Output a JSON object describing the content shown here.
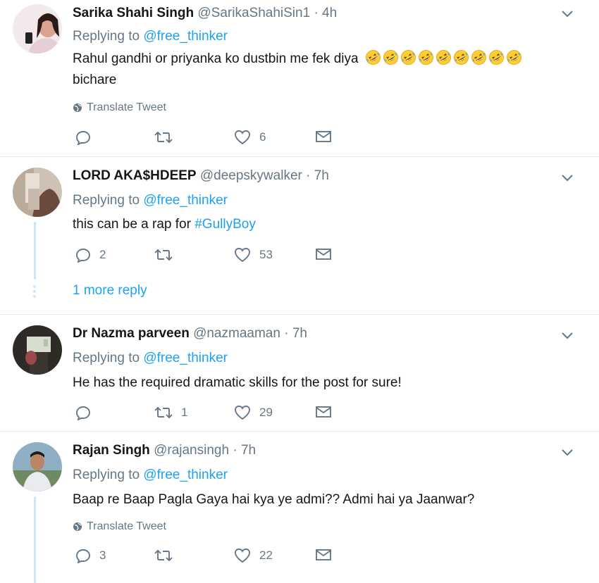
{
  "reply_prefix": "Replying to",
  "tweets": [
    {
      "name": "Sarika Shahi Singh",
      "handle": "@SarikaShahiSin1",
      "dot": "·",
      "time": "4h",
      "replying_to": "@free_thinker",
      "text_line1": "Rahul gandhi or priyanka ko dustbin me fek diya",
      "text_line2": "bichare",
      "emoji_count": 9,
      "translate_label": "Translate Tweet",
      "replies": "",
      "retweets": "",
      "likes": "6"
    },
    {
      "name": "LORD AKA$HDEEP",
      "handle": "@deepskywalker",
      "dot": "·",
      "time": "7h",
      "replying_to": "@free_thinker",
      "text_prefix": "this can be a rap for",
      "hashtag": "#GullyBoy",
      "replies": "2",
      "retweets": "",
      "likes": "53",
      "more_replies": "1 more reply"
    },
    {
      "name": "Dr Nazma parveen",
      "handle": "@nazmaaman",
      "dot": "·",
      "time": "7h",
      "replying_to": "@free_thinker",
      "text": "He has the required dramatic skills for the post for sure!",
      "replies": "",
      "retweets": "1",
      "likes": "29"
    },
    {
      "name": "Rajan Singh",
      "handle": "@rajansingh",
      "dot": "·",
      "time": "7h",
      "replying_to": "@free_thinker",
      "text": "Baap re Baap Pagla Gaya hai kya ye admi?? Admi hai ya Jaanwar?",
      "translate_label": "Translate Tweet",
      "replies": "3",
      "retweets": "",
      "likes": "22"
    }
  ],
  "icons": {
    "reply": "reply-icon",
    "retweet": "retweet-icon",
    "like": "heart-icon",
    "dm": "envelope-icon",
    "caret": "chevron-down-icon",
    "globe": "globe-icon",
    "emoji": "rofl-emoji-icon"
  },
  "colors": {
    "link": "#1da1f2",
    "muted": "#657786",
    "text": "#14171a",
    "thread_line": "#cce6f7"
  }
}
